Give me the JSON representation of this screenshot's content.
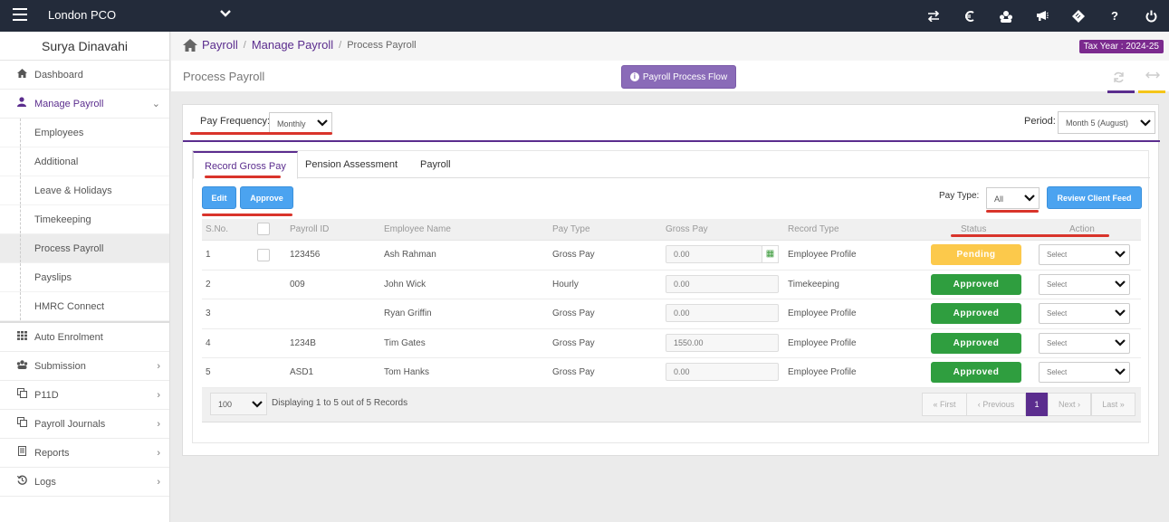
{
  "topbar": {
    "company": "London PCO",
    "icons": [
      "exchange-icon",
      "currency-icon",
      "users-icon",
      "bullhorn-icon",
      "ticket-icon",
      "help-icon",
      "power-icon"
    ]
  },
  "sidebar": {
    "user_name": "Surya Dinavahi",
    "items": [
      {
        "label": "Dashboard",
        "icon": "home-icon"
      },
      {
        "label": "Manage Payroll",
        "icon": "user-icon"
      },
      {
        "label": "Auto Enrolment",
        "icon": "grid-icon"
      },
      {
        "label": "Submission",
        "icon": "users-icon"
      },
      {
        "label": "P11D",
        "icon": "copy-icon"
      },
      {
        "label": "Payroll Journals",
        "icon": "copy-icon"
      },
      {
        "label": "Reports",
        "icon": "document-icon"
      },
      {
        "label": "Logs",
        "icon": "history-icon"
      }
    ],
    "sub_items": [
      "Employees",
      "Additional",
      "Leave & Holidays",
      "Timekeeping",
      "Process Payroll",
      "Payslips",
      "HMRC Connect"
    ]
  },
  "breadcrumb": {
    "items": [
      "Payroll",
      "Manage Payroll",
      "Process Payroll"
    ],
    "separator": "/"
  },
  "tax_year": "Tax Year : 2024-25",
  "page_title": "Process Payroll",
  "flow_button": "Payroll Process Flow",
  "filters": {
    "pay_frequency_label": "Pay Frequency:",
    "pay_frequency_value": "Monthly",
    "period_label": "Period:",
    "period_value": "Month 5 (August)",
    "pay_type_label": "Pay Type:",
    "pay_type_value": "All"
  },
  "tabs": [
    "Record Gross Pay",
    "Pension Assessment",
    "Payroll"
  ],
  "buttons": {
    "edit": "Edit",
    "approve": "Approve",
    "review": "Review Client Feed"
  },
  "table": {
    "headers": [
      "S.No.",
      "Payroll ID",
      "Employee Name",
      "Pay Type",
      "Gross Pay",
      "Record Type",
      "Status",
      "Action"
    ],
    "rows": [
      {
        "sno": "1",
        "payroll_id": "123456",
        "name": "Ash Rahman",
        "pay_type": "Gross Pay",
        "gross_pay": "0.00",
        "record_type": "Employee Profile",
        "status": "Pending",
        "action": "Select"
      },
      {
        "sno": "2",
        "payroll_id": "009",
        "name": "John Wick",
        "pay_type": "Hourly",
        "gross_pay": "0.00",
        "record_type": "Timekeeping",
        "status": "Approved",
        "action": "Select"
      },
      {
        "sno": "3",
        "payroll_id": "",
        "name": "Ryan Griffin",
        "pay_type": "Gross Pay",
        "gross_pay": "0.00",
        "record_type": "Employee Profile",
        "status": "Approved",
        "action": "Select"
      },
      {
        "sno": "4",
        "payroll_id": "1234B",
        "name": "Tim Gates",
        "pay_type": "Gross Pay",
        "gross_pay": "1550.00",
        "record_type": "Employee Profile",
        "status": "Approved",
        "action": "Select"
      },
      {
        "sno": "5",
        "payroll_id": "ASD1",
        "name": "Tom Hanks",
        "pay_type": "Gross Pay",
        "gross_pay": "0.00",
        "record_type": "Employee Profile",
        "status": "Approved",
        "action": "Select"
      }
    ]
  },
  "pager": {
    "per_page": "100",
    "info": "Displaying 1 to 5 out of 5 Records",
    "first": "« First",
    "previous": "‹ Previous",
    "current": "1",
    "next": "Next ›",
    "last": "Last »"
  },
  "colors": {
    "brand_purple": "#5b2d8e",
    "topbar": "#232b3a",
    "pending": "#fcc94b",
    "approved": "#2f9e3f",
    "button_blue": "#4ba3f0",
    "annotation_red": "#d9342b"
  }
}
